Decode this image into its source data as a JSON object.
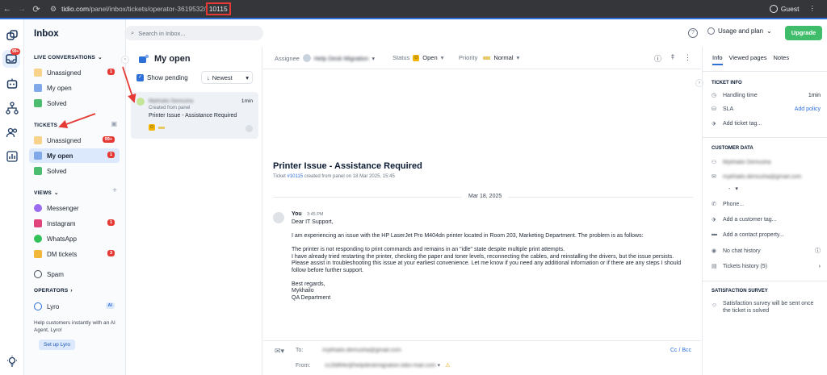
{
  "browser": {
    "url_host": "tidio.com",
    "url_path": "/panel/inbox/tickets/operator-3619532/",
    "url_highlight": "10115",
    "profile_label": "Guest"
  },
  "rail": {
    "inbox_badge": "99+"
  },
  "sidebar": {
    "title": "Inbox",
    "live_section": "LIVE CONVERSATIONS",
    "live_items": [
      {
        "label": "Unassigned",
        "count": "1"
      },
      {
        "label": "My open",
        "count": ""
      },
      {
        "label": "Solved",
        "count": ""
      }
    ],
    "tickets_section": "TICKETS",
    "ticket_items": [
      {
        "label": "Unassigned",
        "count": "99+"
      },
      {
        "label": "My open",
        "count": "1"
      },
      {
        "label": "Solved",
        "count": ""
      }
    ],
    "views_section": "VIEWS",
    "view_items": [
      {
        "label": "Messenger",
        "count": ""
      },
      {
        "label": "Instagram",
        "count": "1"
      },
      {
        "label": "WhatsApp",
        "count": ""
      },
      {
        "label": "DM tickets",
        "count": "3"
      }
    ],
    "spam_label": "Spam",
    "operators_section": "OPERATORS",
    "lyro_label": "Lyro",
    "lyro_badge": "AI",
    "lyro_help": "Help customers instantly with an AI Agent, Lyro!",
    "lyro_button": "Set up Lyro"
  },
  "header": {
    "search_placeholder": "Search in Inbox...",
    "usage_label": "Usage and plan",
    "upgrade_label": "Upgrade"
  },
  "list": {
    "title": "My open",
    "show_pending": "Show pending",
    "sort_label": "Newest",
    "card": {
      "name": "Mykhailo Demusha",
      "time": "1min",
      "sub": "Created from panel",
      "subject": "Printer Issue - Assistance Required",
      "status_letter": "O"
    }
  },
  "main": {
    "assignee_label": "Assignee",
    "assignee_value": "Help Desk Migration",
    "status_label": "Status",
    "status_value": "Open",
    "status_letter": "O",
    "priority_label": "Priority",
    "priority_value": "Normal",
    "subject": "Printer Issue - Assistance Required",
    "meta_prefix": "Ticket",
    "meta_ticket": "#10115",
    "meta_suffix": "created from panel on 18 Mar 2025, 15:45",
    "date_divider": "Mar 18, 2025",
    "message": {
      "from": "You",
      "time": "3:45 PM",
      "greeting": "Dear IT Support,",
      "p1": "I am experiencing an issue with the HP LaserJet Pro M404dn printer located in Room 203, Marketing Department. The problem is as follows:",
      "p2": "The printer is not responding to print commands and remains in an \"idle\" state despite multiple print attempts.",
      "p3": "I have already tried restarting the printer, checking the paper and toner levels, reconnecting the cables, and reinstalling the drivers, but the issue persists.",
      "p4": "Please assist in troubleshooting this issue at your earliest convenience. Let me know if you need any additional information or if there are any steps I should follow before further support.",
      "sign1": "Best regards,",
      "sign2": "Mykhailo",
      "sign3": "QA Department"
    },
    "to_label": "To:",
    "to_value": "mykhailo.demusha@gmail.com",
    "from_label": "From:",
    "from_value": "cc2b8f4e@helpdeskmigration.tidio-mail.com",
    "ccbcc": "Cc / Bcc"
  },
  "right": {
    "tabs": [
      "Info",
      "Viewed pages",
      "Notes"
    ],
    "ticket_info": "TICKET INFO",
    "handling_label": "Handling time",
    "handling_value": "1min",
    "sla_label": "SLA",
    "sla_value": "Add policy",
    "add_tag": "Add ticket tag...",
    "customer_data": "CUSTOMER DATA",
    "cust_name": "Mykhailo Demusha",
    "cust_email": "mykhailo.demusha@gmail.com",
    "cust_select": "-",
    "phone": "Phone...",
    "add_customer_tag": "Add a customer tag...",
    "add_contact_prop": "Add a contact property...",
    "no_chat": "No chat history",
    "tickets_history": "Tickets history (5)",
    "survey_title": "SATISFACTION SURVEY",
    "survey_text": "Satisfaction survey will be sent once the ticket is solved"
  },
  "colors": {
    "accent": "#2f6fd8",
    "upgrade": "#3fbd6a",
    "badge": "#e53935",
    "annotation": "#e53935"
  }
}
